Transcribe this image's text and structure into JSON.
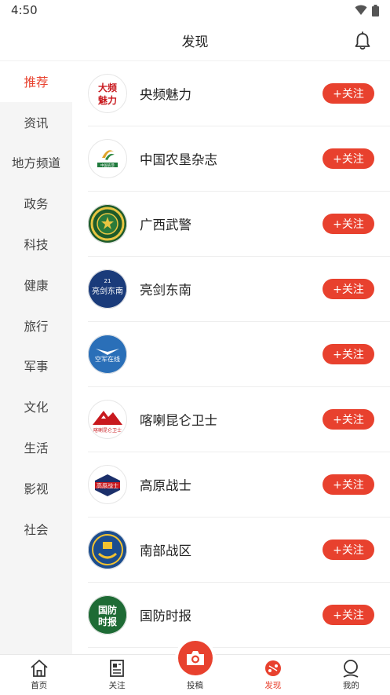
{
  "status": {
    "time": "4:50"
  },
  "header": {
    "title": "发现"
  },
  "sidebar": {
    "items": [
      {
        "label": "推荐"
      },
      {
        "label": "资讯"
      },
      {
        "label": "地方频道"
      },
      {
        "label": "政务"
      },
      {
        "label": "科技"
      },
      {
        "label": "健康"
      },
      {
        "label": "旅行"
      },
      {
        "label": "军事"
      },
      {
        "label": "文化"
      },
      {
        "label": "生活"
      },
      {
        "label": "影视"
      },
      {
        "label": "社会"
      }
    ],
    "active_index": 0
  },
  "channels": [
    {
      "name": "央频魅力",
      "follow": "+关注",
      "logo_text": "大频魅力",
      "logo_bg": "#ffffff",
      "logo_fg": "#c8191e"
    },
    {
      "name": "中国农垦杂志",
      "follow": "+关注",
      "logo_text": "中国农垦",
      "logo_bg": "#ffffff",
      "logo_fg": "#1f7a3c"
    },
    {
      "name": "广西武警",
      "follow": "+关注",
      "logo_text": "",
      "logo_bg": "#1d5b2a",
      "logo_fg": "#e7c542"
    },
    {
      "name": "亮剑东南",
      "follow": "+关注",
      "logo_text": "亮剑东南",
      "logo_bg": "#1a3b7a",
      "logo_fg": "#ffffff"
    },
    {
      "name": "",
      "follow": "+关注",
      "logo_text": "空军在线",
      "logo_bg": "#2a6fb8",
      "logo_fg": "#ffffff"
    },
    {
      "name": "喀喇昆仑卫士",
      "follow": "+关注",
      "logo_text": "喀喇昆仑卫士",
      "logo_bg": "#ffffff",
      "logo_fg": "#c8191e"
    },
    {
      "name": "高原战士",
      "follow": "+关注",
      "logo_text": "高原战士",
      "logo_bg": "#ffffff",
      "logo_fg": "#1b2f6a"
    },
    {
      "name": "南部战区",
      "follow": "+关注",
      "logo_text": "",
      "logo_bg": "#1b4d8f",
      "logo_fg": "#f2c230"
    },
    {
      "name": "国防时报",
      "follow": "+关注",
      "logo_text": "国防时报",
      "logo_bg": "#1e6b35",
      "logo_fg": "#ffffff"
    }
  ],
  "tabs": [
    {
      "label": "首页",
      "icon": "home-icon"
    },
    {
      "label": "关注",
      "icon": "document-icon"
    },
    {
      "label": "投稿",
      "icon": "camera-icon"
    },
    {
      "label": "发现",
      "icon": "discover-icon"
    },
    {
      "label": "我的",
      "icon": "user-icon"
    }
  ],
  "colors": {
    "accent": "#e8412e",
    "sidebar_bg": "#f5f5f5"
  }
}
